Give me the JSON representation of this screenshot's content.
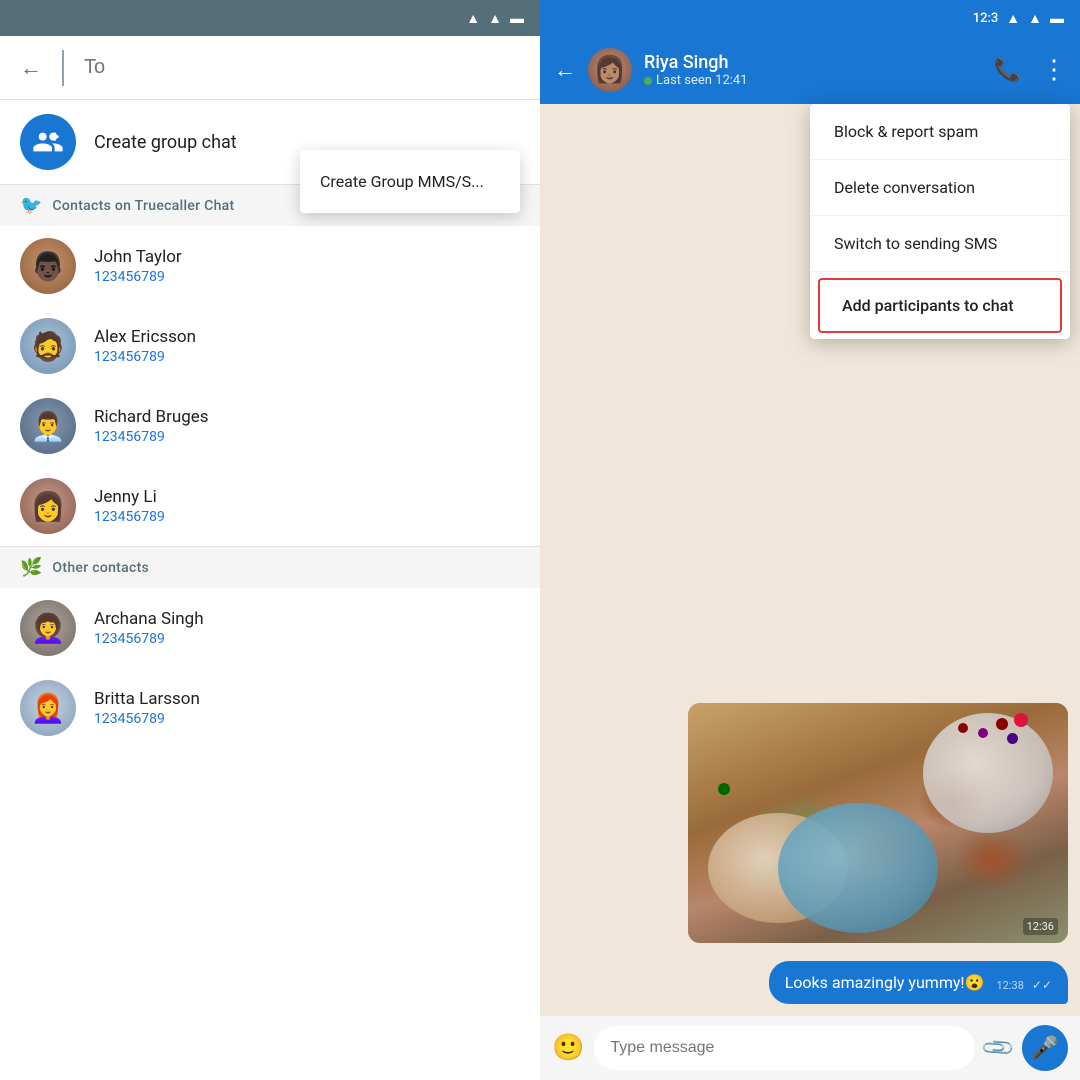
{
  "left": {
    "status_bar": {
      "icons": [
        "wifi",
        "signal",
        "battery"
      ]
    },
    "search": {
      "back_label": "←",
      "to_placeholder": "To"
    },
    "create_group": {
      "label": "Create group chat",
      "dropdown": {
        "item1": "Create Group MMS/S..."
      }
    },
    "section_truecaller": {
      "label": "Contacts on Truecaller Chat"
    },
    "contacts": [
      {
        "id": "john",
        "name": "John Taylor",
        "phone": "123456789"
      },
      {
        "id": "alex",
        "name": "Alex Ericsson",
        "phone": "123456789"
      },
      {
        "id": "richard",
        "name": "Richard Bruges",
        "phone": "123456789"
      },
      {
        "id": "jenny",
        "name": "Jenny Li",
        "phone": "123456789"
      }
    ],
    "section_other": {
      "label": "Other contacts"
    },
    "other_contacts": [
      {
        "id": "archana",
        "name": "Archana Singh",
        "phone": "123456789"
      },
      {
        "id": "britta",
        "name": "Britta Larsson",
        "phone": "123456789"
      }
    ]
  },
  "right": {
    "status_bar": {
      "time": "12:3"
    },
    "header": {
      "back_label": "←",
      "contact_name": "Riya Singh",
      "last_seen": "Last seen 12:41",
      "call_icon": "📞",
      "more_icon": "⋮"
    },
    "context_menu": {
      "item1": "Block & report spam",
      "item2": "Delete conversation",
      "item3": "Switch to sending SMS",
      "item4": "Add participants to chat"
    },
    "message": {
      "text": "Looks amazingly yummy!😮",
      "time": "12:38",
      "ticks": "✓✓"
    },
    "image_timestamp": "12:36",
    "bottom_bar": {
      "placeholder": "Type message"
    }
  }
}
